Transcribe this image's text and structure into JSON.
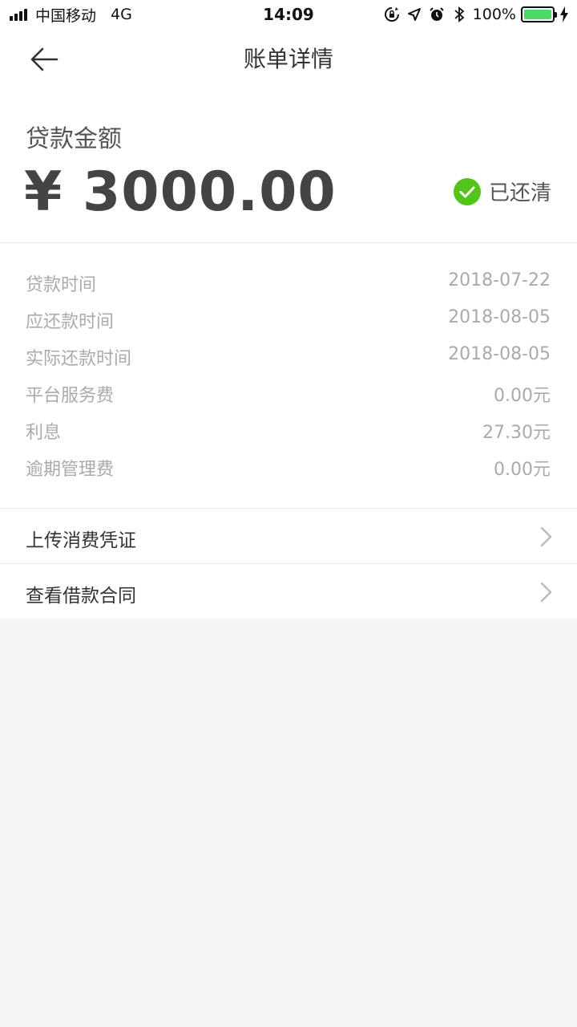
{
  "status_bar": {
    "carrier": "中国移动",
    "network": "4G",
    "time": "14:09",
    "battery_percent": "100%",
    "icons": [
      "orientation-lock-icon",
      "location-arrow-icon",
      "alarm-icon",
      "bluetooth-icon",
      "charging-bolt-icon"
    ],
    "battery_color": "#4cd964"
  },
  "nav": {
    "title": "账单详情",
    "back_icon": "back-arrow-icon"
  },
  "amount_card": {
    "label": "贷款金额",
    "amount": "¥ 3000.00",
    "status": "已还清",
    "status_color": "#52c41a"
  },
  "details": [
    {
      "label": "贷款时间",
      "value": "2018-07-22"
    },
    {
      "label": "应还款时间",
      "value": "2018-08-05"
    },
    {
      "label": "实际还款时间",
      "value": "2018-08-05"
    },
    {
      "label": "平台服务费",
      "value": "0.00元"
    },
    {
      "label": "利息",
      "value": "27.30元"
    },
    {
      "label": "逾期管理费",
      "value": "0.00元"
    }
  ],
  "actions": [
    {
      "label": "上传消费凭证",
      "icon": "chevron-right-icon"
    },
    {
      "label": "查看借款合同",
      "icon": "chevron-right-icon"
    }
  ]
}
